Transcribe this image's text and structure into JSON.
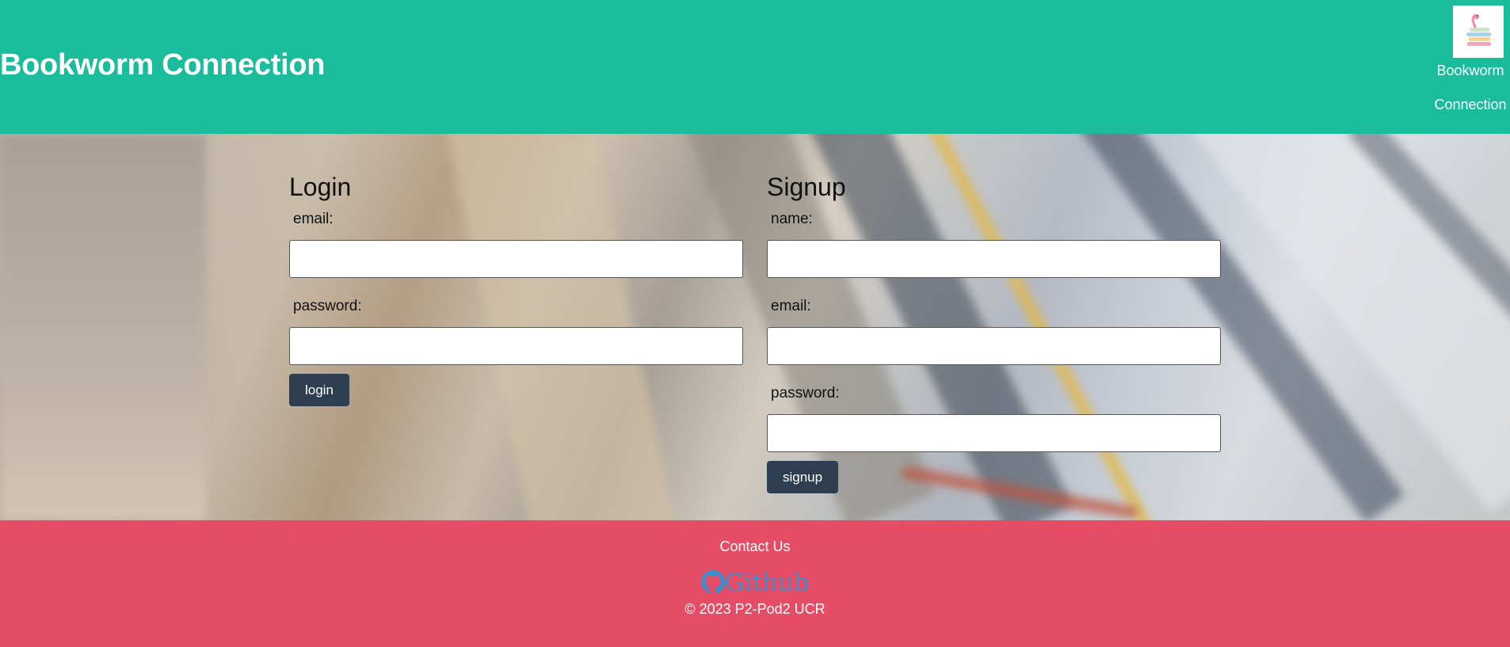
{
  "header": {
    "title": "Bookworm Connection",
    "brand_line1": "Bookworm",
    "brand_line2": "Connection",
    "logo_icon": "bookworm-books-logo-icon"
  },
  "login": {
    "heading": "Login",
    "email_label": "email:",
    "email_value": "",
    "password_label": "password:",
    "password_value": "",
    "button_label": "login"
  },
  "signup": {
    "heading": "Signup",
    "name_label": "name:",
    "name_value": "",
    "email_label": "email:",
    "email_value": "",
    "password_label": "password:",
    "password_value": "",
    "button_label": "signup"
  },
  "footer": {
    "contact_label": "Contact Us",
    "github_label": "Github",
    "github_icon": "github-icon",
    "copyright": "© 2023 P2-Pod2 UCR"
  },
  "colors": {
    "header_bg": "#1abc9c",
    "footer_bg": "#e54c65",
    "button_bg": "#2c3e50",
    "github_link": "#3b8fd0"
  }
}
